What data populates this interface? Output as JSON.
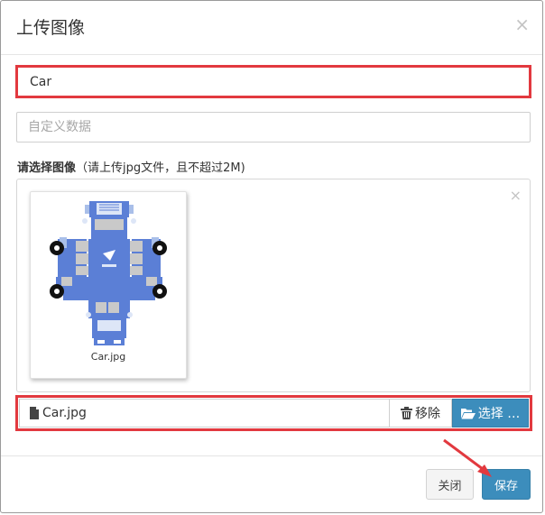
{
  "modal": {
    "title": "上传图像",
    "close_glyph": "×"
  },
  "form": {
    "name_value": "Car",
    "custom_data_placeholder": "自定义数据",
    "image_label_bold": "请选择图像",
    "image_label_hint": "（请上传jpg文件，且不超过2M)"
  },
  "preview": {
    "remove_glyph": "×",
    "file_caption": "Car.jpg"
  },
  "file_input": {
    "caption": "Car.jpg",
    "remove_label": "移除",
    "browse_label": "选择 …"
  },
  "footer": {
    "close_label": "关闭",
    "save_label": "保存"
  },
  "colors": {
    "highlight": "#e2393f",
    "primary": "#3c8dbc",
    "car_blue": "#5b7fd6"
  },
  "icons": [
    "close-icon",
    "file-icon",
    "trash-icon",
    "folder-open-icon",
    "arrow-pointer-icon"
  ]
}
